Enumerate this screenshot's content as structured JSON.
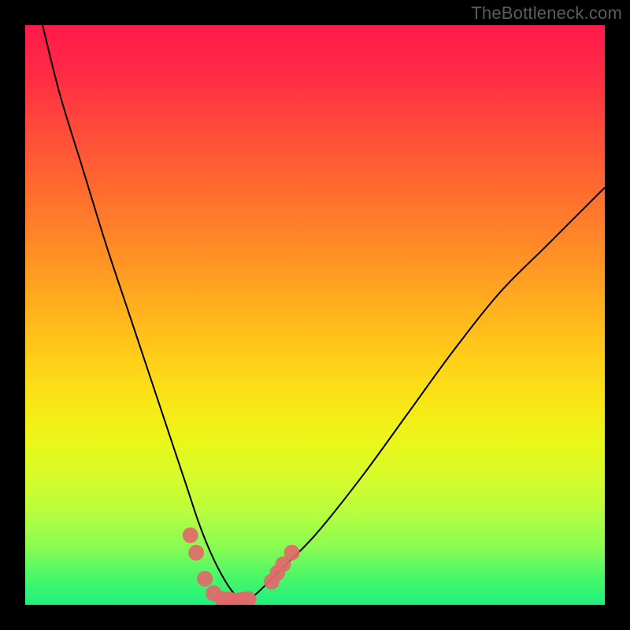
{
  "watermark": {
    "text": "TheBottleneck.com"
  },
  "chart_data": {
    "type": "line",
    "title": "",
    "xlabel": "",
    "ylabel": "",
    "xlim": [
      0,
      100
    ],
    "ylim": [
      0,
      100
    ],
    "grid": false,
    "legend": null,
    "background": {
      "gradient": [
        "#ff1a4b",
        "#ff8a26",
        "#ffd018",
        "#eaf71a",
        "#1ef07e"
      ],
      "direction": "top-to-bottom"
    },
    "series": [
      {
        "name": "bottleneck-curve",
        "color": "#000000",
        "x": [
          3,
          6,
          10,
          14,
          18,
          22,
          26,
          28,
          30,
          32,
          34,
          36,
          38,
          40,
          44,
          50,
          58,
          66,
          74,
          82,
          90,
          100
        ],
        "y": [
          100,
          88,
          75,
          62,
          50,
          38,
          26,
          20,
          14,
          9,
          5,
          2,
          0.8,
          2,
          6,
          12,
          22,
          33,
          44,
          54,
          62,
          72
        ]
      },
      {
        "name": "trough-markers",
        "color": "#e06a6a",
        "type": "scatter",
        "x": [
          28.5,
          29.5,
          31.0,
          32.5,
          34.0,
          35.5,
          37.2,
          38.5,
          42.5,
          43.5,
          44.5,
          46.0
        ],
        "y": [
          12.0,
          9.0,
          4.5,
          2.0,
          1.0,
          0.8,
          0.8,
          1.0,
          4.0,
          5.5,
          7.0,
          9.0
        ]
      }
    ]
  }
}
